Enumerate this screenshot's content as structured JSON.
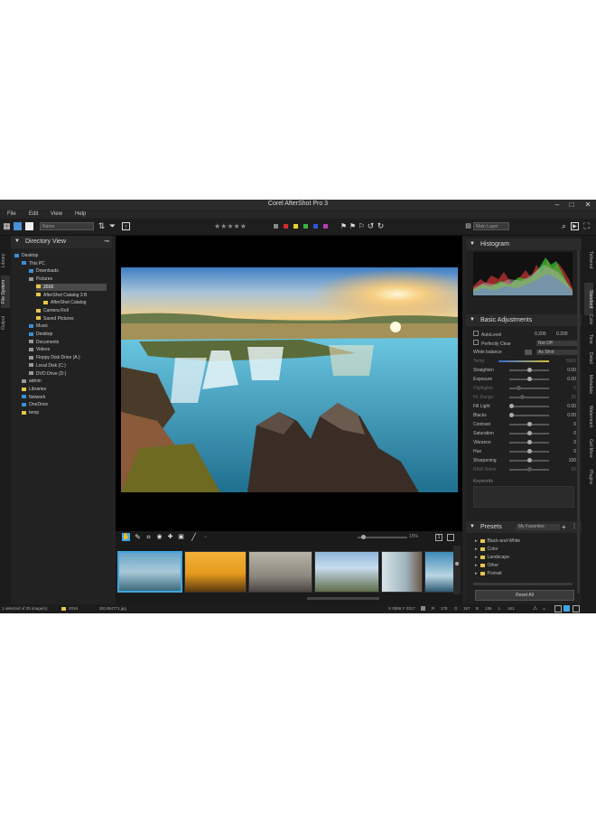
{
  "window": {
    "title": "Corel AfterShot Pro 3",
    "minimize": "–",
    "maximize": "□",
    "close": "✕"
  },
  "menu": [
    "File",
    "Edit",
    "View",
    "Help"
  ],
  "toolbar": {
    "sort_value": "Name",
    "layer_value": "Main Layer",
    "stars": "★★★★★",
    "color_labels": [
      "#888888",
      "#d32a2a",
      "#e8d22a",
      "#3bb33b",
      "#2a5ad3",
      "#b43bb4"
    ]
  },
  "left_tabs": [
    "Library",
    "File System",
    "Output"
  ],
  "directory": {
    "title": "Directory View",
    "nodes": [
      {
        "label": "Desktop",
        "icon": "blue"
      },
      {
        "label": "This PC",
        "icon": "blue"
      },
      {
        "label": "Downloads",
        "icon": "blue"
      },
      {
        "label": "Pictures",
        "icon": "grey"
      },
      {
        "label": "2016",
        "icon": "folder"
      },
      {
        "label": "AfterShot Catalog 3 B",
        "icon": "folder"
      },
      {
        "label": "AfterShot Catalog",
        "icon": "folder"
      },
      {
        "label": "Camera Roll",
        "icon": "folder"
      },
      {
        "label": "Saved Pictures",
        "icon": "folder"
      },
      {
        "label": "Music",
        "icon": "blue"
      },
      {
        "label": "Desktop",
        "icon": "blue"
      },
      {
        "label": "Documents",
        "icon": "grey"
      },
      {
        "label": "Videos",
        "icon": "grey"
      },
      {
        "label": "Floppy Disk Drive (A:)",
        "icon": "grey"
      },
      {
        "label": "Local Disk (C:)",
        "icon": "grey"
      },
      {
        "label": "DVD Drive (D:)",
        "icon": "grey"
      },
      {
        "label": "admin",
        "icon": "grey"
      },
      {
        "label": "Libraries",
        "icon": "folder"
      },
      {
        "label": "Network",
        "icon": "blue"
      },
      {
        "label": "OneDrive",
        "icon": "blue"
      },
      {
        "label": "temp",
        "icon": "folder"
      }
    ]
  },
  "viewer": {
    "zoom": "15%"
  },
  "histogram": {
    "title": "Histogram"
  },
  "adjustments": {
    "title": "Basic Adjustments",
    "autolevel": {
      "label": "AutoLevel",
      "v1": "0.200",
      "v2": "0.200"
    },
    "perfectly_clear": {
      "label": "Perfectly Clear",
      "value": "Not Off"
    },
    "white_balance": {
      "label": "White balance",
      "value": "As Shot"
    },
    "temp": {
      "label": "Temp",
      "value": "5000"
    },
    "rows": [
      {
        "label": "Straighten",
        "value": "0.00",
        "pos": 0.5,
        "dim": false
      },
      {
        "label": "Exposure",
        "value": "0.00",
        "pos": 0.5,
        "dim": false
      },
      {
        "label": "Highlights",
        "value": "0",
        "pos": 0.2,
        "dim": true
      },
      {
        "label": "HL Range",
        "value": "25",
        "pos": 0.3,
        "dim": true
      },
      {
        "label": "Fill Light",
        "value": "0.00",
        "pos": 0.0,
        "dim": false
      },
      {
        "label": "Blacks",
        "value": "0.00",
        "pos": 0.0,
        "dim": false
      },
      {
        "label": "Contrast",
        "value": "0",
        "pos": 0.5,
        "dim": false
      },
      {
        "label": "Saturation",
        "value": "0",
        "pos": 0.5,
        "dim": false
      },
      {
        "label": "Vibrance",
        "value": "0",
        "pos": 0.5,
        "dim": false
      },
      {
        "label": "Hue",
        "value": "0",
        "pos": 0.5,
        "dim": false
      },
      {
        "label": "Sharpening",
        "value": "100",
        "pos": 0.5,
        "dim": false
      },
      {
        "label": "RAW Noise",
        "value": "50",
        "pos": 0.5,
        "dim": true
      }
    ],
    "keywords": "Keywords"
  },
  "presets": {
    "title": "Presets",
    "filter": "My Favorites",
    "items": [
      "Black-and-White",
      "Color",
      "Landscape",
      "Other",
      "Portrait"
    ],
    "reset": "Reset All"
  },
  "right_tabs": [
    "Tethered",
    "Standard",
    "Color",
    "Tone",
    "Detail",
    "Metadata",
    "Watermark",
    "Get More",
    "Plugins"
  ],
  "status": {
    "selection": "1 selected of 25 image(s)",
    "folder": "2016",
    "file": "301454771.jpg",
    "coords": "X 0066 Y 2317",
    "r_label": "R",
    "r": "178",
    "g_label": "G",
    "g": "157",
    "b_label": "B",
    "b": "136",
    "l_label": "L",
    "l": "161"
  }
}
